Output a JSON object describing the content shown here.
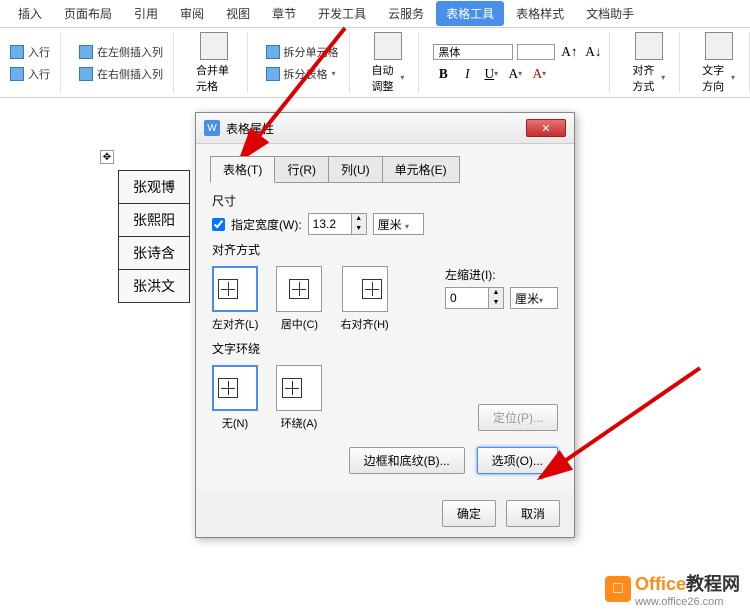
{
  "ribbon": {
    "tabs": [
      "插入",
      "页面布局",
      "引用",
      "审阅",
      "视图",
      "章节",
      "开发工具",
      "云服务",
      "表格工具",
      "表格样式",
      "文档助手"
    ],
    "active_tab_index": 8,
    "insert_row": "入行",
    "insert_col_left": "在左侧插入列",
    "insert_col_right": "在右侧插入列",
    "merge_cells": "合并单元格",
    "split_cells": "拆分单元格",
    "split_table": "拆分表格",
    "auto_adjust": "自动调整",
    "font_name": "黑体",
    "font_size": "",
    "align_mode": "对齐方式",
    "text_direction": "文字方向"
  },
  "table_rows": [
    "张观博",
    "张熙阳",
    "张诗含",
    "张洪文"
  ],
  "dialog": {
    "title": "表格属性",
    "tabs": {
      "table": "表格(T)",
      "row": "行(R)",
      "col": "列(U)",
      "cell": "单元格(E)"
    },
    "size_label": "尺寸",
    "width_chk": "指定宽度(W):",
    "width_value": "13.2",
    "width_unit": "厘米",
    "align_label": "对齐方式",
    "align_left": "左对齐(L)",
    "align_center": "居中(C)",
    "align_right": "右对齐(H)",
    "indent_label": "左缩进(I):",
    "indent_value": "0",
    "indent_unit": "厘米",
    "wrap_label": "文字环绕",
    "wrap_none": "无(N)",
    "wrap_around": "环绕(A)",
    "position_btn": "定位(P)...",
    "border_btn": "边框和底纹(B)...",
    "options_btn": "选项(O)...",
    "ok": "确定",
    "cancel": "取消"
  },
  "watermark": {
    "brand1": "Office",
    "brand2": "教程网",
    "url": "www.office26.com"
  }
}
